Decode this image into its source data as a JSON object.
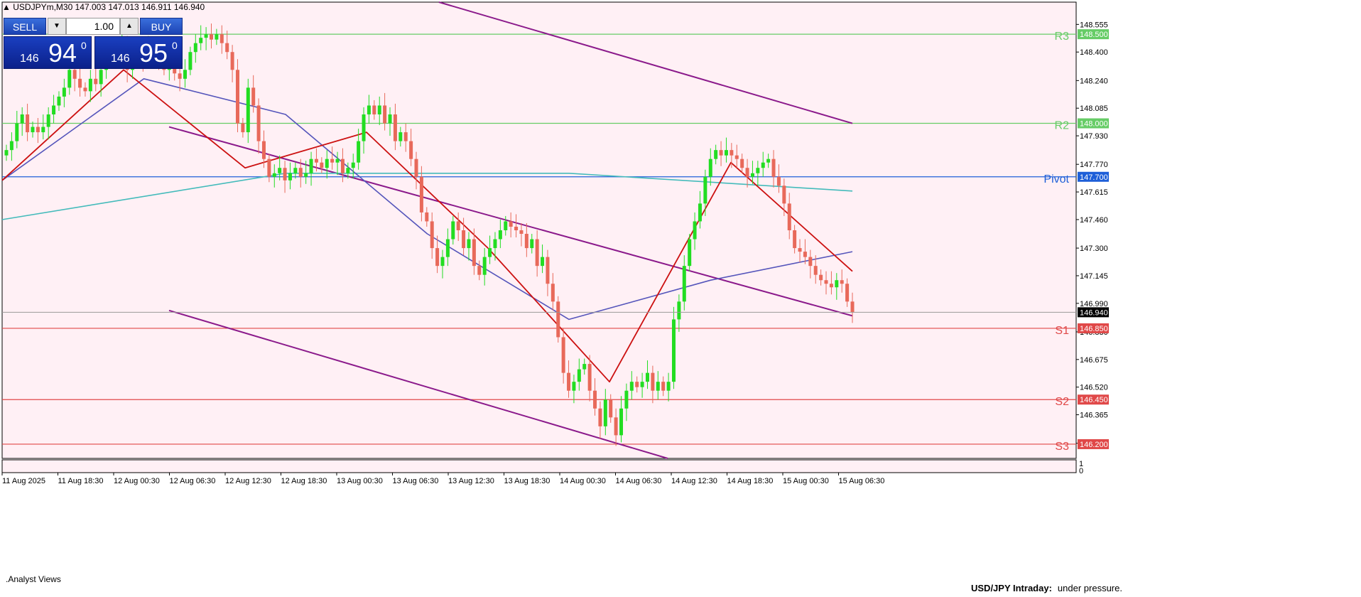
{
  "header": {
    "symbol": "USDJPYm,M30",
    "ohlc": "147.003 147.013 146.911 146.940"
  },
  "trade_panel": {
    "sell_label": "SELL",
    "buy_label": "BUY",
    "lot": "1.00",
    "sell_price": {
      "small": "146",
      "big": "94",
      "sup": "0"
    },
    "buy_price": {
      "small": "146",
      "big": "95",
      "sup": "0"
    }
  },
  "indicator_panel": {
    "label": ".Analyst Views",
    "scale_top": "1",
    "scale_bottom": "0"
  },
  "annotation": {
    "title": "USD/JPY Intraday:",
    "text": "under pressure."
  },
  "colors": {
    "background": "#FFF0F5",
    "bull": "#22DD22",
    "bear": "#E8695A",
    "resistance": "#66CC66",
    "support": "#E04848",
    "pivot": "#1E5FD8",
    "ma_fast": "#CC1111",
    "ma_mid": "#5555BB",
    "ma_slow": "#44BBBB",
    "channel": "#8B1A8B"
  },
  "chart_data": {
    "type": "candlestick",
    "symbol": "USDJPYm",
    "timeframe": "M30",
    "ylim": [
      146.12,
      148.68
    ],
    "y_ticks": [
      "148.555",
      "148.400",
      "148.240",
      "148.085",
      "147.930",
      "147.770",
      "147.615",
      "147.460",
      "147.300",
      "147.145",
      "146.990",
      "146.830",
      "146.675",
      "146.520",
      "146.365",
      "146.205"
    ],
    "x_ticks": [
      "11 Aug 2025",
      "11 Aug 18:30",
      "12 Aug 00:30",
      "12 Aug 06:30",
      "12 Aug 12:30",
      "12 Aug 18:30",
      "13 Aug 00:30",
      "13 Aug 06:30",
      "13 Aug 12:30",
      "13 Aug 18:30",
      "14 Aug 00:30",
      "14 Aug 06:30",
      "14 Aug 12:30",
      "14 Aug 18:30",
      "15 Aug 00:30",
      "15 Aug 06:30"
    ],
    "current_price": "146.940",
    "levels": [
      {
        "name": "R3",
        "value": "148.500",
        "kind": "resistance"
      },
      {
        "name": "R2",
        "value": "148.000",
        "kind": "resistance"
      },
      {
        "name": "Pivot",
        "value": "147.700",
        "kind": "pivot"
      },
      {
        "name": "S1",
        "value": "146.850",
        "kind": "support"
      },
      {
        "name": "S2",
        "value": "146.450",
        "kind": "support"
      },
      {
        "name": "S3",
        "value": "146.200",
        "kind": "support"
      }
    ],
    "candles_close": [
      147.85,
      147.9,
      148.0,
      148.05,
      147.95,
      147.98,
      147.95,
      147.98,
      148.05,
      148.1,
      148.15,
      148.2,
      148.3,
      148.25,
      148.2,
      148.18,
      148.25,
      148.22,
      148.3,
      148.35,
      148.4,
      148.38,
      148.45,
      148.3,
      148.35,
      148.4,
      148.35,
      148.42,
      148.4,
      148.35,
      148.3,
      148.33,
      148.28,
      148.25,
      148.3,
      148.4,
      148.45,
      148.48,
      148.5,
      148.47,
      148.5,
      148.45,
      148.4,
      148.3,
      148.0,
      147.95,
      148.2,
      148.1,
      147.9,
      147.8,
      147.7,
      147.72,
      147.75,
      147.68,
      147.72,
      147.75,
      147.7,
      147.72,
      147.8,
      147.78,
      147.75,
      147.8,
      147.78,
      147.8,
      147.72,
      147.75,
      147.78,
      147.9,
      148.05,
      148.1,
      148.05,
      148.1,
      148.0,
      148.05,
      147.9,
      147.95,
      147.9,
      147.8,
      147.7,
      147.5,
      147.45,
      147.3,
      147.2,
      147.25,
      147.35,
      147.45,
      147.4,
      147.3,
      147.35,
      147.2,
      147.15,
      147.25,
      147.3,
      147.35,
      147.4,
      147.45,
      147.42,
      147.4,
      147.38,
      147.3,
      147.35,
      147.2,
      147.25,
      147.1,
      147.0,
      146.8,
      146.6,
      146.5,
      146.55,
      146.62,
      146.65,
      146.5,
      146.4,
      146.3,
      146.45,
      146.35,
      146.25,
      146.4,
      146.5,
      146.55,
      146.52,
      146.55,
      146.6,
      146.5,
      146.55,
      146.5,
      146.55,
      146.9,
      147.0,
      147.2,
      147.35,
      147.45,
      147.55,
      147.7,
      147.8,
      147.85,
      147.82,
      147.85,
      147.82,
      147.8,
      147.75,
      147.7,
      147.72,
      147.75,
      147.78,
      147.8,
      147.7,
      147.65,
      147.55,
      147.4,
      147.3,
      147.28,
      147.25,
      147.2,
      147.15,
      147.12,
      147.1,
      147.08,
      147.12,
      147.1,
      147.0,
      146.94
    ],
    "ma_fast_close": [
      147.68,
      148.3,
      147.75,
      147.95,
      147.3,
      146.55,
      147.78,
      147.17
    ],
    "ma_mid_close": [
      147.68,
      148.25,
      148.05,
      147.38,
      146.9,
      147.12,
      147.28
    ],
    "ma_slow_close": [
      147.46,
      147.72,
      147.72,
      147.62
    ],
    "channel_upper_close": [
      148.68,
      148.0
    ],
    "channel_mid_close": [
      147.98,
      146.92
    ],
    "channel_lower_close": [
      146.95,
      146.12
    ],
    "legend": "none",
    "grid": false
  }
}
